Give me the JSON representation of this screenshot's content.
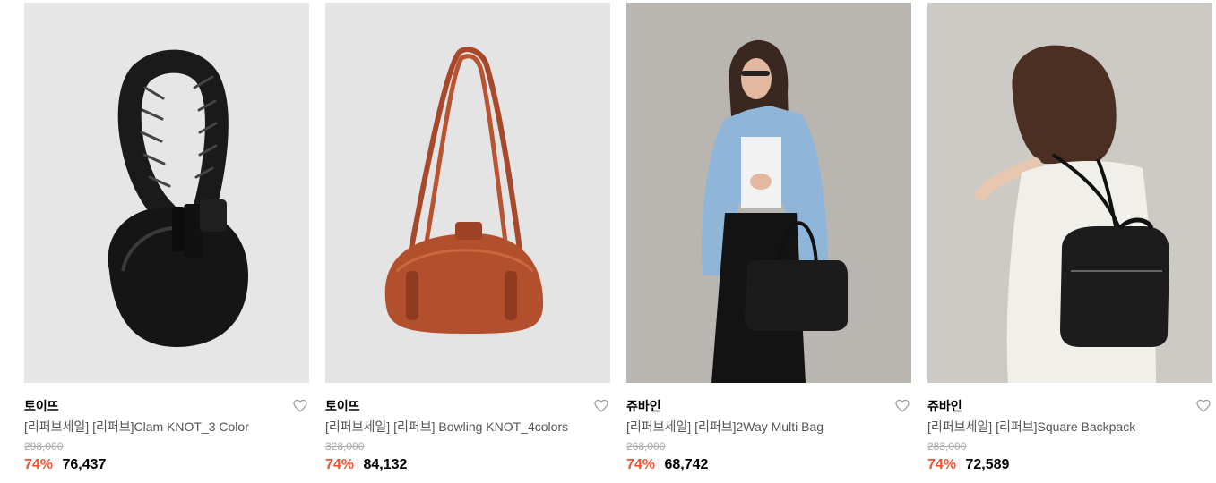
{
  "products": [
    {
      "brand": "토이뜨",
      "name": "[리퍼브세일] [리퍼브]Clam KNOT_3 Color",
      "original_price": "298,000",
      "discount": "74%",
      "price": "76,437",
      "image": "black-knot-handle-bag",
      "bg_color": "#e6e6e6"
    },
    {
      "brand": "토이뜨",
      "name": "[리퍼브세일] [리퍼브] Bowling KNOT_4colors",
      "original_price": "328,000",
      "discount": "74%",
      "price": "84,132",
      "image": "brown-bowling-bag",
      "bg_color": "#e4e4e4"
    },
    {
      "brand": "쥬바인",
      "name": "[리퍼브세일] [리퍼브]2Way Multi Bag",
      "original_price": "268,000",
      "discount": "74%",
      "price": "68,742",
      "image": "model-with-black-tote",
      "bg_color": "#b9b6b2"
    },
    {
      "brand": "쥬바인",
      "name": "[리퍼브세일] [리퍼브]Square Backpack",
      "original_price": "283,000",
      "discount": "74%",
      "price": "72,589",
      "image": "model-with-black-backpack",
      "bg_color": "#cdc9c4"
    }
  ],
  "colors": {
    "discount": "#f0562d",
    "brand_text": "#000000",
    "name_text": "#555555",
    "strikethrough": "#aaaaaa"
  }
}
